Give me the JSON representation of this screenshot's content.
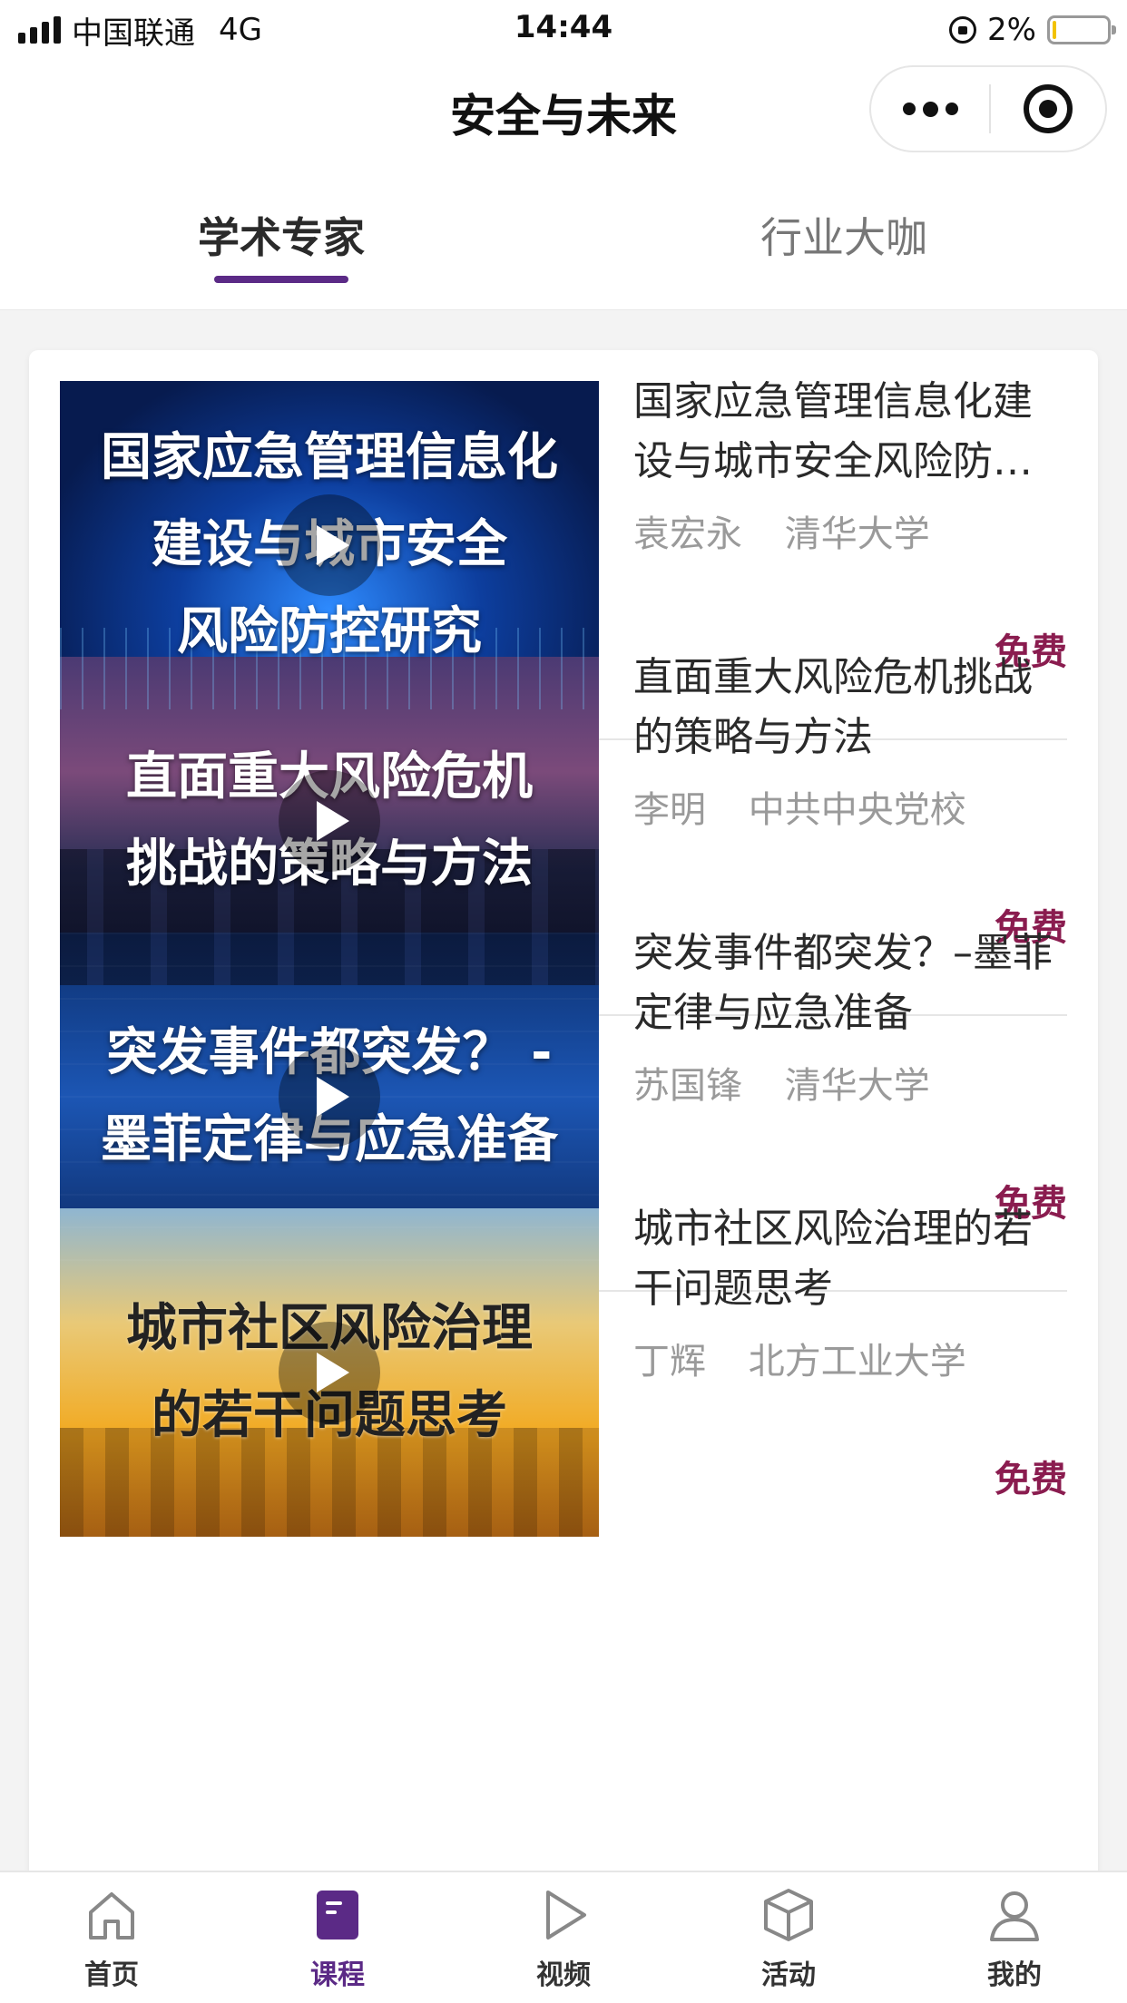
{
  "status_bar": {
    "carrier": "中国联通",
    "network": "4G",
    "time": "14:44",
    "battery": "2%",
    "battery_level": 0.02
  },
  "nav": {
    "title": "安全与未来",
    "more_icon": "more-dots-icon",
    "close_icon": "target-close-icon"
  },
  "tabs": [
    {
      "label": "学术专家",
      "active": true
    },
    {
      "label": "行业大咖",
      "active": false
    }
  ],
  "courses": [
    {
      "thumb_text": [
        "国家应急管理信息化",
        "建设与城市安全",
        "风险防控研究"
      ],
      "title": "国家应急管理信息化建设与城市安全风险防…",
      "speaker": "袁宏永",
      "org": "清华大学",
      "price": "免费"
    },
    {
      "thumb_text": [
        "直面重大风险危机",
        "挑战的策略与方法"
      ],
      "title": "直面重大风险危机挑战的策略与方法",
      "speaker": "李明",
      "org": "中共中央党校",
      "price": "免费"
    },
    {
      "thumb_text": [
        "突发事件都突发？ -",
        "墨菲定律与应急准备"
      ],
      "title": "突发事件都突发？–墨菲定律与应急准备",
      "speaker": "苏国锋",
      "org": "清华大学",
      "price": "免费"
    },
    {
      "thumb_text": [
        "城市社区风险治理",
        "的若干问题思考"
      ],
      "title": "城市社区风险治理的若干问题思考",
      "speaker": "丁辉",
      "org": "北方工业大学",
      "price": "免费"
    }
  ],
  "tabbar": [
    {
      "label": "首页",
      "icon": "home-icon",
      "active": false
    },
    {
      "label": "课程",
      "icon": "course-book-icon",
      "active": true
    },
    {
      "label": "视频",
      "icon": "play-icon",
      "active": false
    },
    {
      "label": "活动",
      "icon": "box-icon",
      "active": false
    },
    {
      "label": "我的",
      "icon": "user-icon",
      "active": false
    }
  ],
  "colors": {
    "accent": "#5b2a86",
    "price": "#8a1c4f",
    "background": "#f3f3f3"
  }
}
